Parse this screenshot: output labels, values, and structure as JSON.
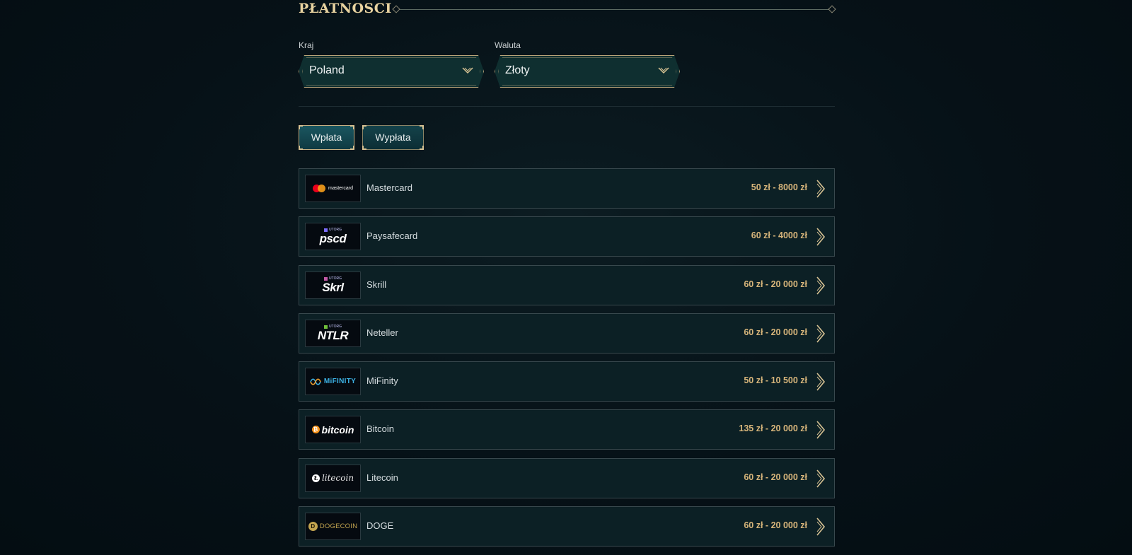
{
  "header": {
    "title": "PŁATNOSCI"
  },
  "filters": {
    "country": {
      "label": "Kraj",
      "value": "Poland"
    },
    "currency": {
      "label": "Waluta",
      "value": "Złoty"
    }
  },
  "tabs": [
    {
      "label": "Wpłata",
      "active": true
    },
    {
      "label": "Wypłata",
      "active": false
    }
  ],
  "methods": [
    {
      "name": "Mastercard",
      "limits": "50 zł - 8000 zł",
      "logo_text": "mastercard"
    },
    {
      "name": "Paysafecard",
      "limits": "60 zł - 4000 zł",
      "logo_tag": "UTORG",
      "logo_text": "pscd"
    },
    {
      "name": "Skrill",
      "limits": "60 zł - 20 000 zł",
      "logo_tag": "UTORG",
      "logo_text": "Skrl"
    },
    {
      "name": "Neteller",
      "limits": "60 zł - 20 000 zł",
      "logo_tag": "UTORG",
      "logo_text": "NTLR"
    },
    {
      "name": "MiFinity",
      "limits": "50 zł - 10 500 zł",
      "logo_text": "MiFINITY"
    },
    {
      "name": "Bitcoin",
      "limits": "135 zł - 20 000 zł",
      "logo_text": "bitcoin"
    },
    {
      "name": "Litecoin",
      "limits": "60 zł - 20 000 zł",
      "logo_text": "litecoin"
    },
    {
      "name": "DOGE",
      "limits": "60 zł - 20 000 zł",
      "logo_text": "DOGECOIN"
    }
  ],
  "colors": {
    "background": "#061117",
    "accent_gold": "#d6b47a",
    "row_bg": "#0c2025",
    "select_bg": "#0f2f30"
  },
  "icons": {
    "select_chevron": "chevron-down-icon",
    "row_arrow": "chevron-right-icon"
  }
}
